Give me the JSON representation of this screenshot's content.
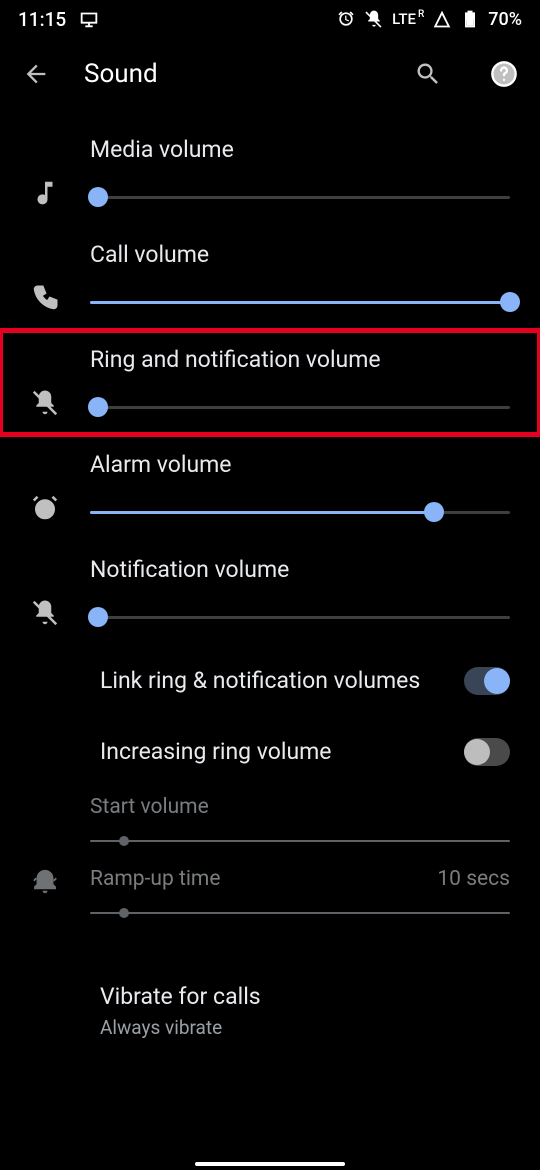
{
  "status": {
    "time": "11:15",
    "network": "LTE",
    "roaming": "R",
    "battery": "70%"
  },
  "header": {
    "title": "Sound"
  },
  "sliders": {
    "media": {
      "label": "Media volume",
      "value": 2
    },
    "call": {
      "label": "Call volume",
      "value": 100
    },
    "ring": {
      "label": "Ring and notification volume",
      "value": 2
    },
    "alarm": {
      "label": "Alarm volume",
      "value": 82
    },
    "notif": {
      "label": "Notification volume",
      "value": 2
    }
  },
  "toggles": {
    "link": {
      "label": "Link ring & notification volumes",
      "on": true
    },
    "increasing": {
      "label": "Increasing ring volume",
      "on": false
    }
  },
  "increasing": {
    "start_label": "Start volume",
    "start_value": 8,
    "ramp_label": "Ramp-up time",
    "ramp_display": "10 secs",
    "ramp_value": 8
  },
  "vibrate": {
    "title": "Vibrate for calls",
    "subtitle": "Always vibrate"
  },
  "colors": {
    "accent": "#8ab4f8",
    "highlight": "#e4001e"
  }
}
